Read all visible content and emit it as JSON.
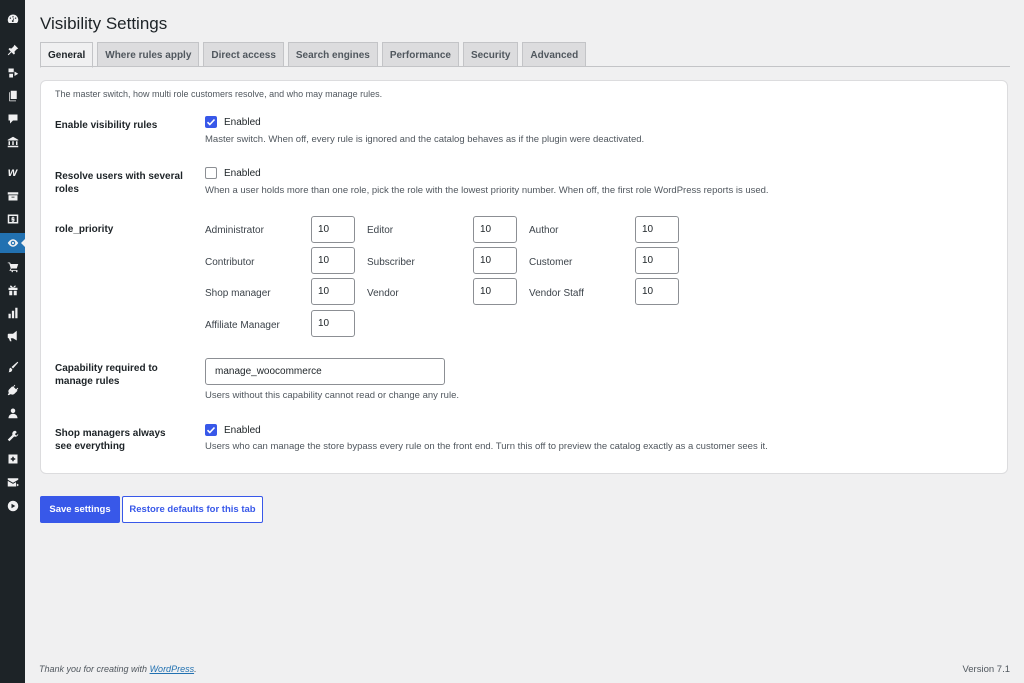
{
  "sidebar": {
    "icons": [
      "dashboard-icon",
      "pin-icon",
      "media-icon",
      "pages-icon",
      "comments-icon",
      "bank-icon",
      "woo-icon",
      "archive-icon",
      "money-icon",
      "visibility-icon",
      "cart-icon",
      "gift-icon",
      "stats-icon",
      "megaphone-icon",
      "brush-icon",
      "plugin-icon",
      "user-icon",
      "wrench-icon",
      "plus-square-icon",
      "mail-icon",
      "play-icon"
    ],
    "active": "visibility-icon"
  },
  "page": {
    "title": "Visibility Settings"
  },
  "tabs": [
    {
      "label": "General",
      "active": true
    },
    {
      "label": "Where rules apply"
    },
    {
      "label": "Direct access"
    },
    {
      "label": "Search engines"
    },
    {
      "label": "Performance"
    },
    {
      "label": "Security"
    },
    {
      "label": "Advanced"
    }
  ],
  "card": {
    "description": "The master switch, how multi role customers resolve, and who may manage rules.",
    "enable": {
      "label": "Enable visibility rules",
      "checkbox_label": "Enabled",
      "checked": true,
      "help": "Master switch. When off, every rule is ignored and the catalog behaves as if the plugin were deactivated."
    },
    "resolve": {
      "label": "Resolve users with several roles",
      "checkbox_label": "Enabled",
      "checked": false,
      "help": "When a user holds more than one role, pick the role with the lowest priority number. When off, the first role WordPress reports is used."
    },
    "priority": {
      "label": "role_priority",
      "roles": [
        {
          "name": "Administrator",
          "value": "10"
        },
        {
          "name": "Editor",
          "value": "10"
        },
        {
          "name": "Author",
          "value": "10"
        },
        {
          "name": "Contributor",
          "value": "10"
        },
        {
          "name": "Subscriber",
          "value": "10"
        },
        {
          "name": "Customer",
          "value": "10"
        },
        {
          "name": "Shop manager",
          "value": "10"
        },
        {
          "name": "Vendor",
          "value": "10"
        },
        {
          "name": "Vendor Staff",
          "value": "10"
        },
        {
          "name": "Affiliate Manager",
          "value": "10"
        }
      ]
    },
    "capability": {
      "label": "Capability required to manage rules",
      "value": "manage_woocommerce",
      "help": "Users without this capability cannot read or change any rule."
    },
    "shop_managers": {
      "label": "Shop managers always see everything",
      "checkbox_label": "Enabled",
      "checked": true,
      "help": "Users who can manage the store bypass every rule on the front end. Turn this off to preview the catalog exactly as a customer sees it."
    }
  },
  "buttons": {
    "save": "Save settings",
    "restore": "Restore defaults for this tab"
  },
  "footer": {
    "thanks": "Thank you for creating with ",
    "link": "WordPress",
    "suffix": ".",
    "version": "Version 7.1"
  },
  "colors": {
    "accent": "#3858e9",
    "sidebar": "#1d2327",
    "active_menu": "#2271b1"
  }
}
